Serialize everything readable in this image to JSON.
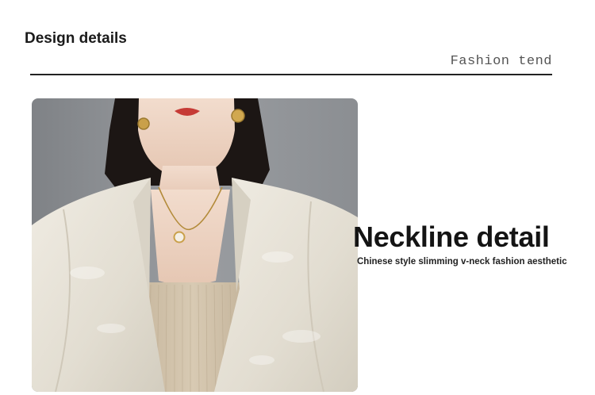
{
  "section": {
    "title": "Design details",
    "subtitle": "Fashion tend"
  },
  "feature": {
    "headline": "Neckline detail",
    "caption": "Chinese style slimming v-neck fashion aesthetic"
  },
  "photo": {
    "palette": {
      "background": "#8d9094",
      "jacket": "#e6e1d6",
      "inner_top": "#d2c3ab",
      "skin": "#ecd2c0",
      "hair": "#1c1614",
      "lips": "#c63b36",
      "gold": "#c9a04a"
    }
  }
}
